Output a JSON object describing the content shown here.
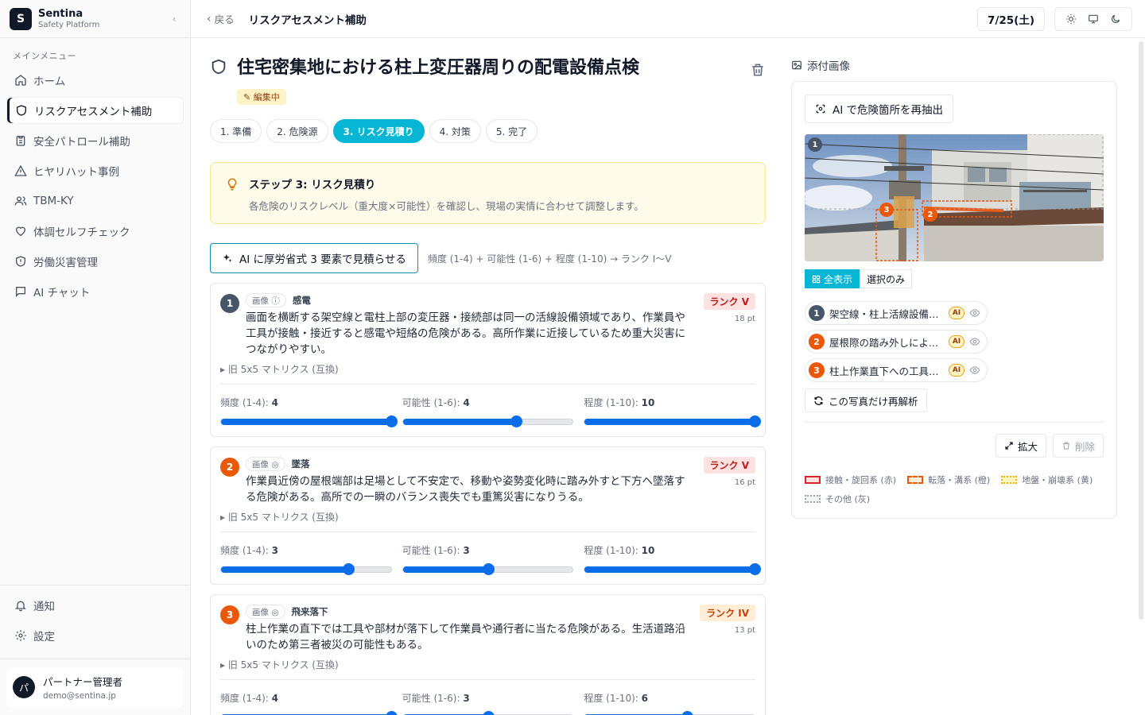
{
  "brand": {
    "logo_letter": "S",
    "name": "Sentina",
    "sub": "Safety Platform"
  },
  "sidebar": {
    "menu_label": "メインメニュー",
    "items": [
      {
        "label": "ホーム"
      },
      {
        "label": "リスクアセスメント補助"
      },
      {
        "label": "安全パトロール補助"
      },
      {
        "label": "ヒヤリハット事例"
      },
      {
        "label": "TBM-KY"
      },
      {
        "label": "体調セルフチェック"
      },
      {
        "label": "労働災害管理"
      },
      {
        "label": "AI チャット"
      }
    ],
    "bottom": [
      {
        "label": "通知"
      },
      {
        "label": "設定"
      }
    ],
    "user": {
      "initial": "パ",
      "name": "パートナー管理者",
      "email": "demo@sentina.jp"
    }
  },
  "topbar": {
    "back": "戻る",
    "crumb": "リスクアセスメント補助",
    "date": "7/25(土)"
  },
  "page": {
    "title": "住宅密集地における柱上変圧器周りの配電設備点検",
    "status_badge": "✎ 編集中",
    "steps": [
      "1. 準備",
      "2. 危険源",
      "3. リスク見積り",
      "4. 対策",
      "5. 完了"
    ],
    "hint": {
      "title": "ステップ 3: リスク見積り",
      "body": "各危険のリスクレベル（重大度×可能性）を確認し、現場の実情に合わせて調整します。"
    },
    "ai_button": "AI に厚労省式 3 要素で見積らせる",
    "formula": "頻度 (1-4) + 可能性 (1-6) + 程度 (1-10) → ランク I〜V"
  },
  "hazards": [
    {
      "num": "1",
      "color": "#475569",
      "image_chip": "画像 ⓘ",
      "category": "感電",
      "desc": "画面を横断する架空線と電柱上部の変圧器・接続部は同一の活線設備領域であり、作業員や工具が接触・接近すると感電や短絡の危険がある。高所作業に近接しているため重大災害につながりやすい。",
      "rank": "ランク V",
      "rank_level": "v",
      "points": "18 pt",
      "legacy": "▸ 旧 5x5 マトリクス (互換)",
      "freq_label": "頻度 (1-4): ",
      "freq": 4,
      "freq_max": 4,
      "poss_label": "可能性 (1-6): ",
      "poss": 4,
      "poss_max": 6,
      "sev_label": "程度 (1-10): ",
      "sev": 10,
      "sev_max": 10
    },
    {
      "num": "2",
      "color": "#ea580c",
      "image_chip": "画像 ◎",
      "category": "墜落",
      "desc": "作業員近傍の屋根端部は足場として不安定で、移動や姿勢変化時に踏み外すと下方へ墜落する危険がある。高所での一瞬のバランス喪失でも重篤災害になりうる。",
      "rank": "ランク V",
      "rank_level": "v",
      "points": "16 pt",
      "legacy": "▸ 旧 5x5 マトリクス (互換)",
      "freq_label": "頻度 (1-4): ",
      "freq": 3,
      "freq_max": 4,
      "poss_label": "可能性 (1-6): ",
      "poss": 3,
      "poss_max": 6,
      "sev_label": "程度 (1-10): ",
      "sev": 10,
      "sev_max": 10
    },
    {
      "num": "3",
      "color": "#ea580c",
      "image_chip": "画像 ◎",
      "category": "飛来落下",
      "desc": "柱上作業の直下では工具や部材が落下して作業員や通行者に当たる危険がある。生活道路沿いのため第三者被災の可能性もある。",
      "rank": "ランク IV",
      "rank_level": "iv",
      "points": "13 pt",
      "legacy": "▸ 旧 5x5 マトリクス (互換)",
      "freq_label": "頻度 (1-4): ",
      "freq": 4,
      "freq_max": 4,
      "poss_label": "可能性 (1-6): ",
      "poss": 3,
      "poss_max": 6,
      "sev_label": "程度 (1-10): ",
      "sev": 6,
      "sev_max": 10
    }
  ],
  "photo_panel": {
    "title": "添付画像",
    "reextract": "AI で危険箇所を再抽出",
    "toggle_all": "全表示",
    "toggle_selected": "選択のみ",
    "items": [
      {
        "num": "1",
        "color": "#475569",
        "label": "架空線・柱上活線設備へ...",
        "ai": "AI"
      },
      {
        "num": "2",
        "color": "#ea580c",
        "label": "屋根際の踏み外しによる...",
        "ai": "AI"
      },
      {
        "num": "3",
        "color": "#ea580c",
        "label": "柱上作業直下への工具・...",
        "ai": "AI"
      }
    ],
    "reanalyze": "この写真だけ再解析",
    "expand": "拡大",
    "delete": "削除",
    "legend": [
      {
        "label": "接触・旋回系 (赤)",
        "color": "#dc2626"
      },
      {
        "label": "転落・溝系 (橙)",
        "color": "#ea580c"
      },
      {
        "label": "地盤・崩壊系 (黄)",
        "color": "#eab308"
      },
      {
        "label": "その他 (灰)",
        "color": "#9ca3af"
      }
    ]
  }
}
